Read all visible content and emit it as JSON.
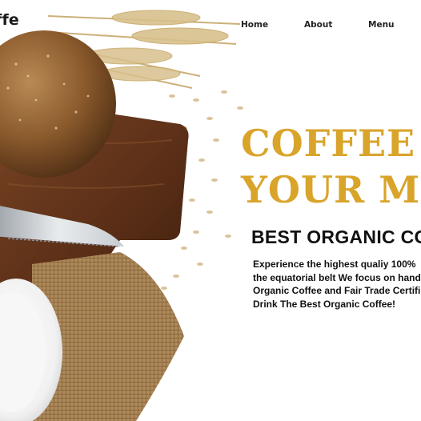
{
  "brand": {
    "logo_text": "ffe"
  },
  "nav": {
    "items": [
      "Home",
      "About",
      "Menu"
    ]
  },
  "hero": {
    "title_line1": "COFFEE",
    "title_line2": "YOUR MI",
    "title_color": "#d9a42a",
    "subtitle": "BEST ORGANIC CO",
    "description_lines": [
      "Experience the highest qualiy 100%",
      "the equatorial belt We focus on hand",
      "Organic Coffee and Fair Trade Certifi",
      "Drink The Best Organic Coffee!"
    ]
  },
  "background": {
    "elements": [
      "bread-loaf",
      "wooden-cutting-board",
      "bread-knife",
      "wheat-stalks",
      "scattered-grains",
      "burlap-cloth",
      "white-cup"
    ]
  }
}
